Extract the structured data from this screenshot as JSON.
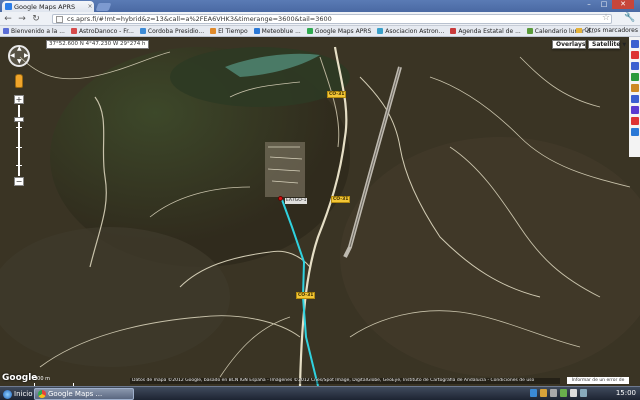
{
  "browser": {
    "tab_title": "Google Maps APRS",
    "tab_close": "×",
    "url": "cs.aprs.fi/#!mt=hybrid&z=13&call=a%2FEA6VHK3&timerange=3600&tail=3600",
    "back": "←",
    "forward": "→",
    "reload": "↻",
    "star": "☆",
    "wrench": "🔧",
    "window_min": "–",
    "window_max": "□",
    "window_close": "✕"
  },
  "bookmarks": [
    {
      "label": "Bienvenido a la ...",
      "color": "#5a6dd6"
    },
    {
      "label": "AstroDanoco - Fr...",
      "color": "#d64a4a"
    },
    {
      "label": "Cordoba Presidio...",
      "color": "#3d8bd6"
    },
    {
      "label": "El Tiempo",
      "color": "#e08a2a"
    },
    {
      "label": "Meteoblue ...",
      "color": "#2a78d6"
    },
    {
      "label": "Google Maps APRS",
      "color": "#2fa84f"
    },
    {
      "label": "Asociacion Astron...",
      "color": "#3aa0c9"
    },
    {
      "label": "Agenda Estatal de ...",
      "color": "#c93a3a"
    },
    {
      "label": "Calendario lunar d...",
      "color": "#5a9a3a"
    }
  ],
  "bookmarks_other": "Otros marcadores",
  "map": {
    "coords": "37°52.600 N 4°47.230 W  29°274 h",
    "overlays_label": "Overlays",
    "satellite_label": "Satellite",
    "zoom_in": "+",
    "zoom_out": "−",
    "station_label": "EA7GO-1",
    "road_labels": [
      "CO-31",
      "CO-31",
      "CO-31"
    ],
    "logo": "Google",
    "scale_label": "500 m",
    "attribution": "Datos de mapa ©2012 Google, basado en BCN IGN España - Imágenes ©2012 Cnes/Spot Image, DigitalGlobe, GeoEye, Instituto de Cartografía de Andalucía - Condiciones de uso",
    "report": "Informar de un error de mapa",
    "track_color": "#2fd2e0"
  },
  "taskbar": {
    "start": "Inicio",
    "task_label": "Google Maps ...",
    "clock": "15:00"
  }
}
